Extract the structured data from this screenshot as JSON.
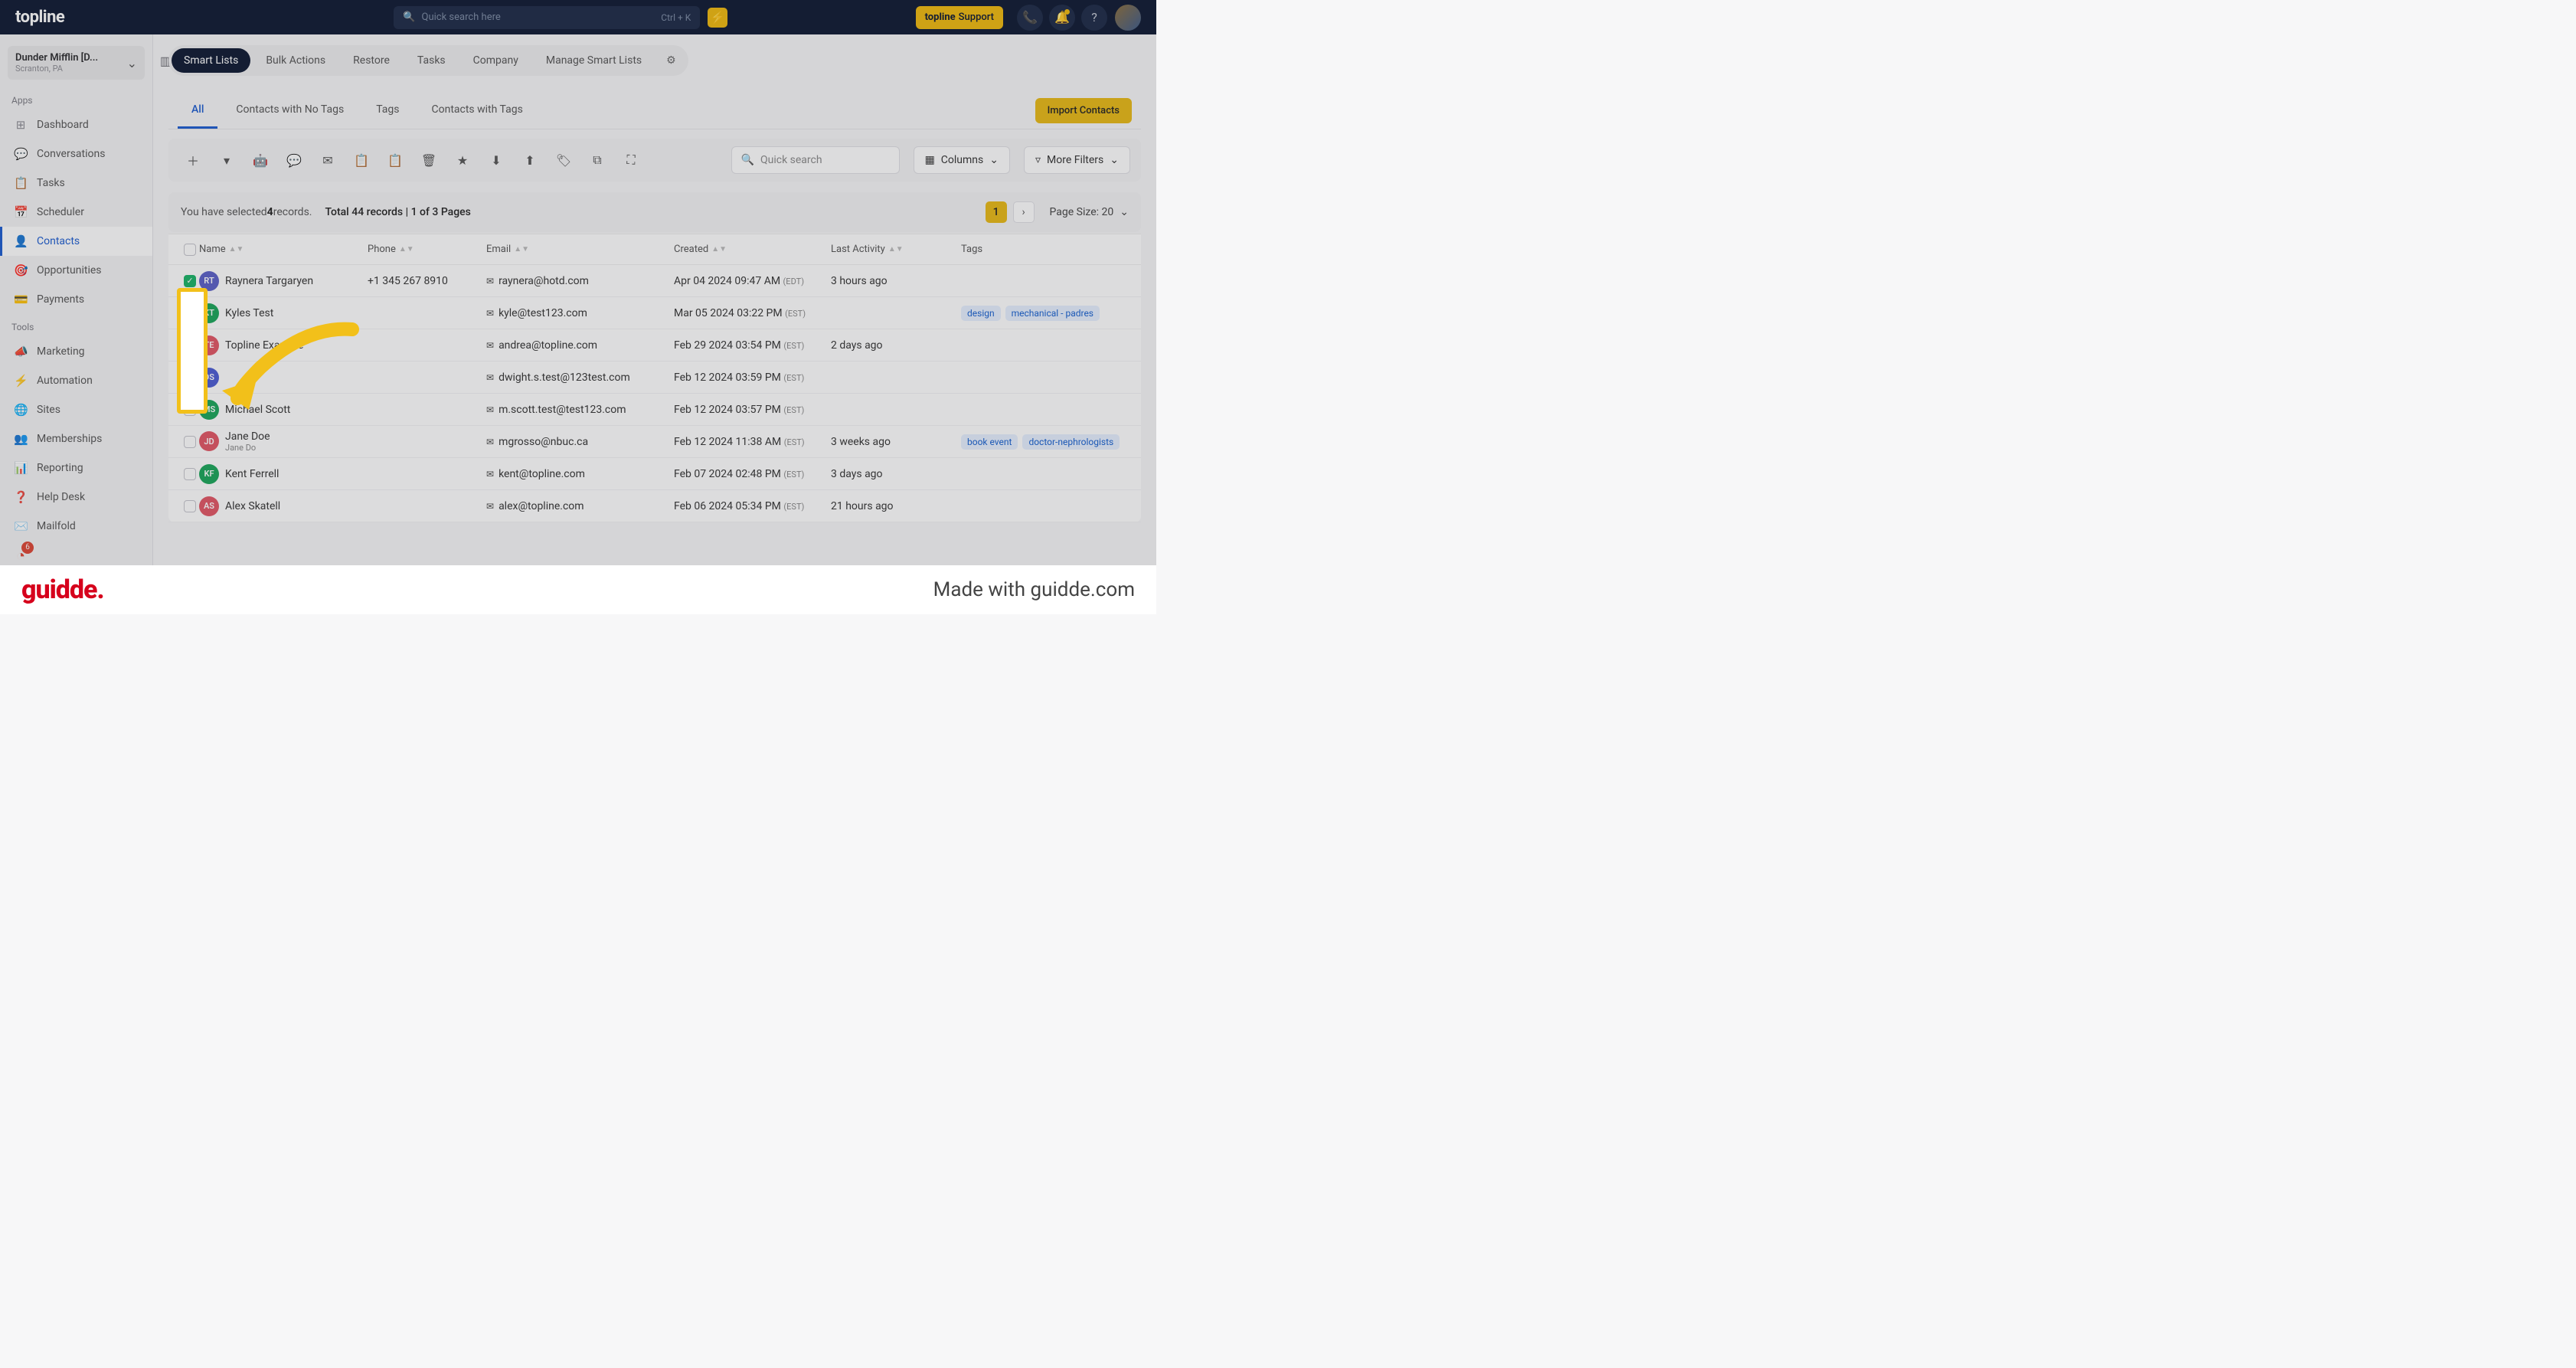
{
  "brand": "topline",
  "search": {
    "placeholder": "Quick search here",
    "shortcut": "Ctrl + K"
  },
  "support_label": "topline Support",
  "workspace": {
    "name": "Dunder Mifflin [D...",
    "location": "Scranton, PA"
  },
  "sidebar": {
    "apps_label": "Apps",
    "tools_label": "Tools",
    "apps": [
      {
        "icon": "⊞",
        "label": "Dashboard"
      },
      {
        "icon": "💬",
        "label": "Conversations"
      },
      {
        "icon": "📋",
        "label": "Tasks"
      },
      {
        "icon": "📅",
        "label": "Scheduler"
      },
      {
        "icon": "👤",
        "label": "Contacts"
      },
      {
        "icon": "🎯",
        "label": "Opportunities"
      },
      {
        "icon": "💳",
        "label": "Payments"
      }
    ],
    "tools": [
      {
        "icon": "📣",
        "label": "Marketing"
      },
      {
        "icon": "⚡",
        "label": "Automation"
      },
      {
        "icon": "🌐",
        "label": "Sites"
      },
      {
        "icon": "👥",
        "label": "Memberships"
      },
      {
        "icon": "📊",
        "label": "Reporting"
      },
      {
        "icon": "❓",
        "label": "Help Desk"
      },
      {
        "icon": "✉️",
        "label": "Mailfold"
      }
    ],
    "badge_count": "6"
  },
  "tabs": [
    "Smart Lists",
    "Bulk Actions",
    "Restore",
    "Tasks",
    "Company",
    "Manage Smart Lists"
  ],
  "subtabs": [
    "All",
    "Contacts with No Tags",
    "Tags",
    "Contacts with Tags"
  ],
  "import_label": "Import Contacts",
  "quicksearch_placeholder": "Quick search",
  "columns_label": "Columns",
  "filters_label": "More Filters",
  "selection": {
    "prefix": "You have selected ",
    "count": "4",
    "suffix": " records.",
    "total_pre": "Total ",
    "total": "44 records",
    "pages": "1 of 3 Pages",
    "current_page": "1",
    "page_size_label": "Page Size: 20"
  },
  "headers": {
    "name": "Name",
    "phone": "Phone",
    "email": "Email",
    "created": "Created",
    "lastact": "Last Activity",
    "tags": "Tags"
  },
  "rows": [
    {
      "checked": true,
      "init": "RT",
      "color": "#5a5fc7",
      "name": "Raynera Targaryen",
      "phone": "+1 345 267 8910",
      "email": "raynera@hotd.com",
      "created": "Apr 04 2024 09:47 AM",
      "tz": "(EDT)",
      "lastact": "3 hours ago",
      "tags": []
    },
    {
      "checked": true,
      "init": "KT",
      "color": "#18a558",
      "name": "Kyles Test",
      "phone": "",
      "email": "kyle@test123.com",
      "created": "Mar 05 2024 03:22 PM",
      "tz": "(EST)",
      "lastact": "",
      "tags": [
        "design",
        "mechanical - padres"
      ]
    },
    {
      "checked": true,
      "init": "TE",
      "color": "#e25563",
      "name": "Topline Example",
      "phone": "",
      "email": "andrea@topline.com",
      "created": "Feb 29 2024 03:54 PM",
      "tz": "(EST)",
      "lastact": "2 days ago",
      "tags": []
    },
    {
      "checked": true,
      "init": "DS",
      "color": "#4a5bd4",
      "name": "",
      "phone": "",
      "email": "dwight.s.test@123test.com",
      "created": "Feb 12 2024 03:59 PM",
      "tz": "(EST)",
      "lastact": "",
      "tags": []
    },
    {
      "checked": false,
      "init": "MS",
      "color": "#18a558",
      "name": "Michael Scott",
      "phone": "",
      "email": "m.scott.test@test123.com",
      "created": "Feb 12 2024 03:57 PM",
      "tz": "(EST)",
      "lastact": "",
      "tags": []
    },
    {
      "checked": false,
      "init": "JD",
      "color": "#e25563",
      "name": "Jane Doe",
      "sub": "Jane Do",
      "phone": "",
      "email": "mgrosso@nbuc.ca",
      "created": "Feb 12 2024 11:38 AM",
      "tz": "(EST)",
      "lastact": "3 weeks ago",
      "tags": [
        "book event",
        "doctor-nephrologists"
      ]
    },
    {
      "checked": false,
      "init": "KF",
      "color": "#18a558",
      "name": "Kent Ferrell",
      "phone": "",
      "email": "kent@topline.com",
      "created": "Feb 07 2024 02:48 PM",
      "tz": "(EST)",
      "lastact": "3 days ago",
      "tags": []
    },
    {
      "checked": false,
      "init": "AS",
      "color": "#e25563",
      "name": "Alex Skatell",
      "phone": "",
      "email": "alex@topline.com",
      "created": "Feb 06 2024 05:34 PM",
      "tz": "(EST)",
      "lastact": "21 hours ago",
      "tags": []
    }
  ],
  "footer": {
    "logo": "guidde.",
    "made": "Made with guidde.com"
  }
}
